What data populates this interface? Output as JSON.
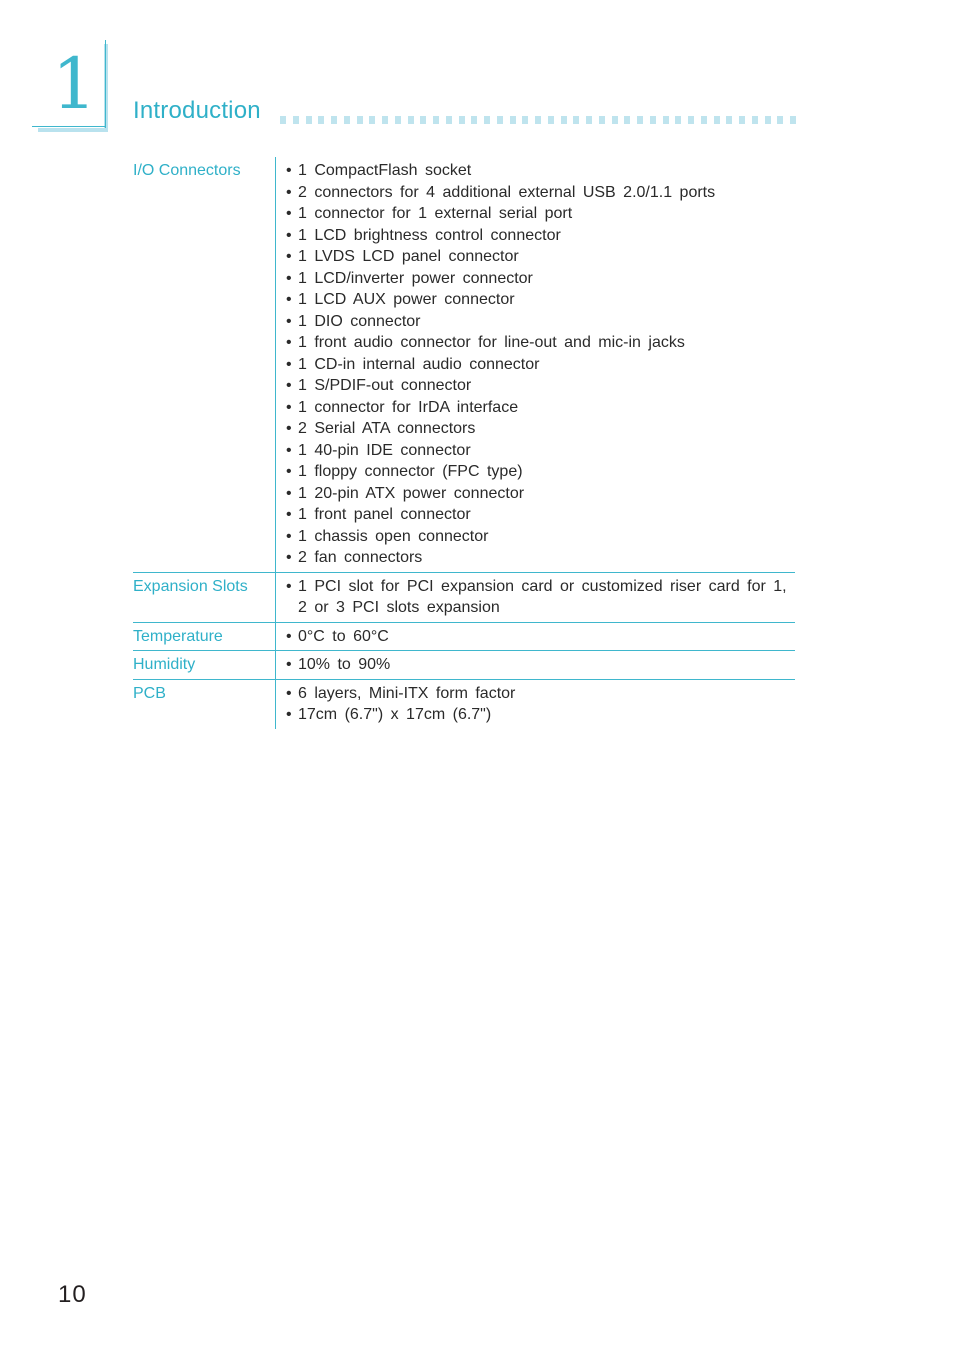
{
  "chapter": {
    "number": "1",
    "title": "Introduction"
  },
  "spec_table": {
    "rows": [
      {
        "label": "I/O  Connectors",
        "items": [
          "1  CompactFlash  socket",
          "2  connectors  for  4  additional  external  USB  2.0/1.1  ports",
          "1  connector  for  1  external  serial  port",
          "1  LCD  brightness  control  connector",
          "1  LVDS  LCD  panel  connector",
          "1  LCD/inverter  power  connector",
          "1  LCD  AUX  power  connector",
          "1  DIO  connector",
          "1  front  audio  connector  for  line-out  and  mic-in  jacks",
          "1  CD-in  internal  audio  connector",
          "1  S/PDIF-out  connector",
          "1  connector  for  IrDA  interface",
          "2  Serial  ATA  connectors",
          "1  40-pin  IDE  connector",
          "1  floppy  connector  (FPC  type)",
          "1  20-pin  ATX  power  connector",
          "1  front  panel  connector",
          "1  chassis  open  connector",
          "2  fan  connectors"
        ]
      },
      {
        "label": "Expansion  Slots",
        "items": [
          "1  PCI  slot  for  PCI  expansion  card  or  customized  riser  card  for  1,  2  or  3  PCI  slots  expansion"
        ]
      },
      {
        "label": "Temperature",
        "items": [
          "0°C  to  60°C"
        ]
      },
      {
        "label": "Humidity",
        "items": [
          "10%  to  90%"
        ]
      },
      {
        "label": "PCB",
        "items": [
          "6  layers,  Mini-ITX  form  factor",
          "17cm  (6.7\")  x  17cm  (6.7\")"
        ]
      }
    ]
  },
  "footer": {
    "page_number": "10"
  },
  "colors": {
    "accent": "#2fb0c8",
    "accent_light": "#bfe4ee"
  }
}
